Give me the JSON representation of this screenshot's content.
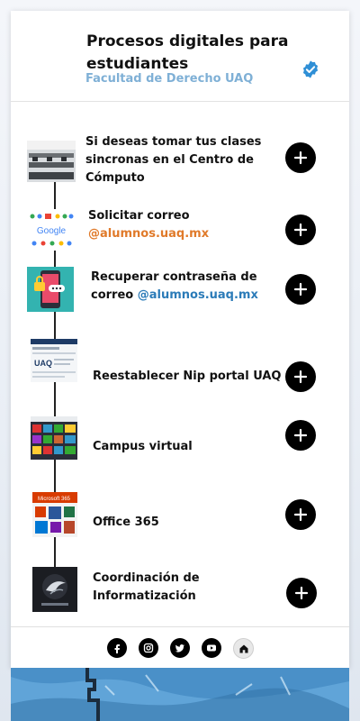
{
  "header": {
    "title": "Procesos digitales para estudiantes",
    "subtitle": "Facultad de Derecho UAQ",
    "verified_icon": "verified-badge-icon",
    "accent_color": "#2f8fd6"
  },
  "items": [
    {
      "label": "Si deseas tomar tus clases sincronas en el Centro de Cómputo",
      "accent": "",
      "thumb": "computer-lab-photo"
    },
    {
      "label": "Solicitar correo",
      "accent": "@alumnos.uaq.mx",
      "accent_color": "#e07a2a",
      "thumb": "google-apps-logo"
    },
    {
      "label": "Recuperar contraseña de correo",
      "accent": "@alumnos.uaq.mx",
      "accent_color": "#2b7bb8",
      "thumb": "phone-lock-illustration"
    },
    {
      "label": "Reestablecer Nip portal UAQ",
      "accent": "",
      "thumb": "uaq-portal-screenshot"
    },
    {
      "label": "Campus virtual",
      "accent": "",
      "thumb": "campus-virtual-screenshot"
    },
    {
      "label": "Office 365",
      "accent": "",
      "thumb": "office-365-screenshot"
    },
    {
      "label": "Coordinación de Informatización",
      "accent": "",
      "thumb": "informatizacion-logo"
    }
  ],
  "footer": {
    "social": [
      "facebook-icon",
      "instagram-icon",
      "twitter-icon",
      "youtube-icon",
      "home-icon"
    ]
  }
}
